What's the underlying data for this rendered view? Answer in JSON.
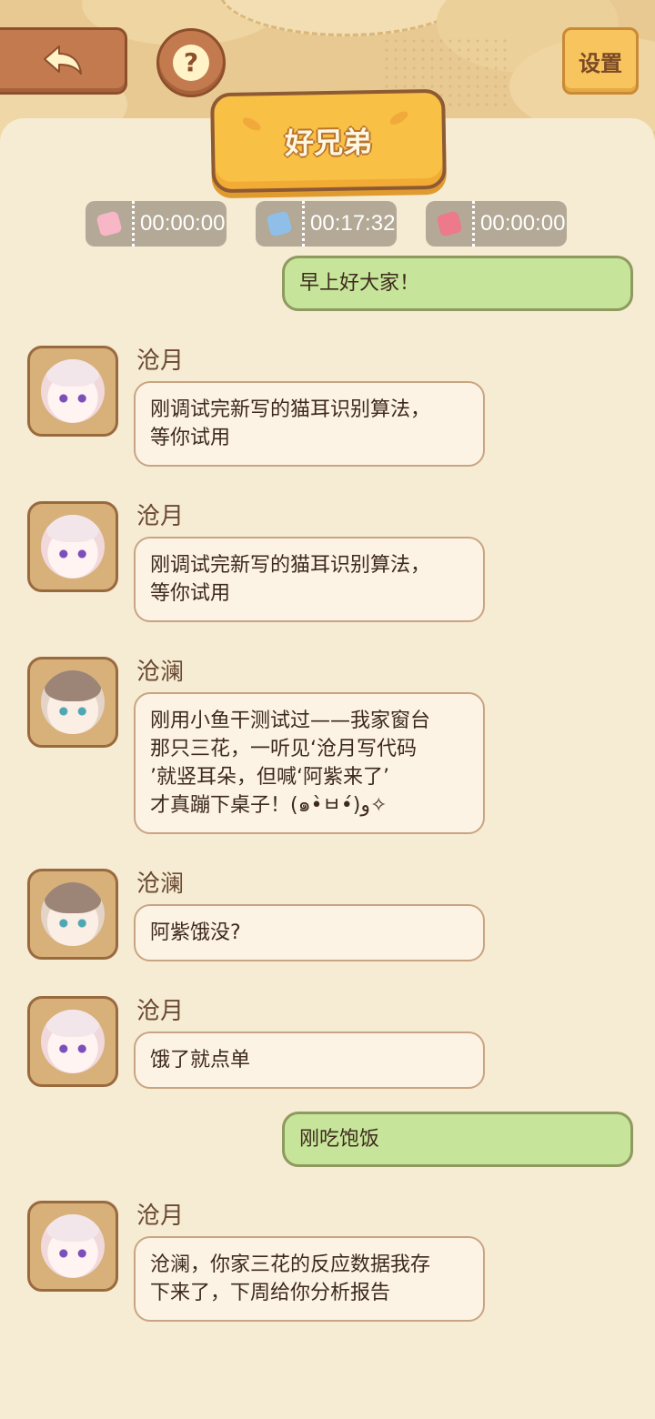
{
  "header": {
    "settings_label": "设置",
    "title": "好兄弟"
  },
  "timers": [
    {
      "icon": "card-icon-pink",
      "value": "00:00:00",
      "color": "#f7b7c7"
    },
    {
      "icon": "card-icon-blue",
      "value": "00:17:32",
      "color": "#8fbfe8"
    },
    {
      "icon": "card-icon-red",
      "value": "00:00:00",
      "color": "#ec7a8a"
    }
  ],
  "messages": [
    {
      "type": "mine",
      "text": "早上好大家！"
    },
    {
      "type": "other",
      "sender": "沧月",
      "text": "刚调试完新写的猫耳识别算法，\n等你试用"
    },
    {
      "type": "other",
      "sender": "沧月",
      "text": "刚调试完新写的猫耳识别算法，\n等你试用"
    },
    {
      "type": "other",
      "sender": "沧澜",
      "text": "刚用小鱼干测试过——我家窗台\n那只三花，一听见‘沧月写代码\n’就竖耳朵，但喊‘阿紫来了’\n才真蹦下桌子！(๑•̀ㅂ•́)و✧"
    },
    {
      "type": "other",
      "sender": "沧澜",
      "text": "阿紫饿没?"
    },
    {
      "type": "other",
      "sender": "沧月",
      "text": "饿了就点单"
    },
    {
      "type": "mine",
      "text": "刚吃饱饭"
    },
    {
      "type": "other",
      "sender": "沧月",
      "text": "沧澜，你家三花的反应数据我存\n下来了，下周给你分析报告"
    }
  ],
  "colors": {
    "background": "#f6ebd3",
    "my_bubble": "#c7e59a",
    "other_bubble": "#fdf3e4",
    "title_banner": "#f8c045"
  }
}
